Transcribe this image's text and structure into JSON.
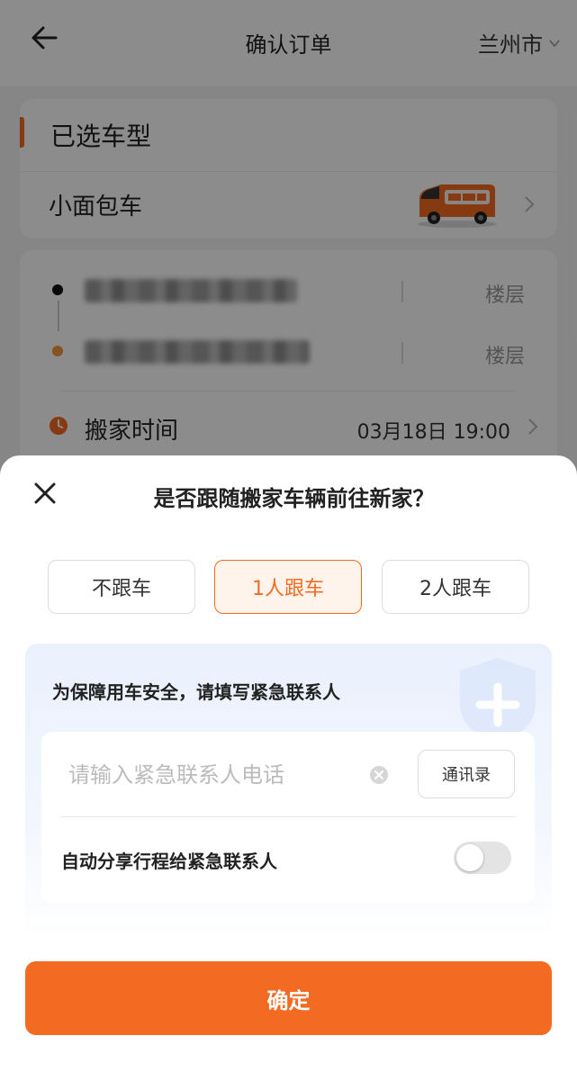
{
  "header": {
    "title": "确认订单",
    "city": "兰州市"
  },
  "vehicle": {
    "section_title": "已选车型",
    "name": "小面包车",
    "image_icon": "van-image"
  },
  "route": {
    "floor_label_1": "楼层",
    "floor_label_2": "楼层",
    "time_label": "搬家时间",
    "time_value": "03月18日 19:00"
  },
  "sheet": {
    "title": "是否跟随搬家车辆前往新家？",
    "options": [
      "不跟车",
      "1人跟车",
      "2人跟车"
    ],
    "selected_option": "1人跟车",
    "safety_title": "为保障用车安全，请填写紧急联系人",
    "phone_placeholder": "请输入紧急联系人电话",
    "contacts_label": "通讯录",
    "share_label": "自动分享行程给紧急联系人",
    "share_enabled": false,
    "confirm_label": "确定"
  },
  "colors": {
    "accent": "#f36a22",
    "selected_bg": "#fff4ec",
    "safety_bg": "#eaf1fd"
  }
}
